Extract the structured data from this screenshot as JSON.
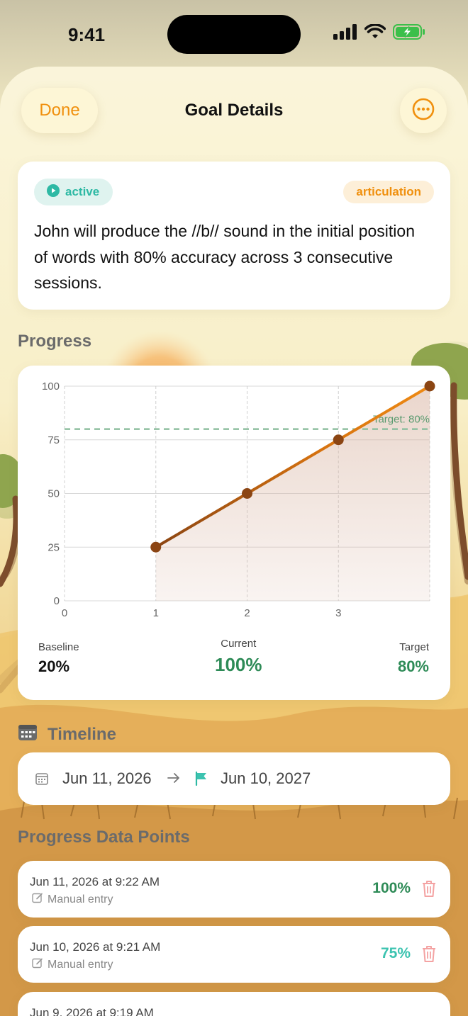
{
  "status_bar": {
    "time": "9:41"
  },
  "nav": {
    "done_label": "Done",
    "title": "Goal Details",
    "more_icon": "ellipsis-circle-icon"
  },
  "goal": {
    "status": "active",
    "category": "articulation",
    "description": "John will produce the //b// sound in the initial position of words with 80% accuracy across 3 consecutive sessions."
  },
  "progress": {
    "section_title": "Progress",
    "chart_data": {
      "type": "line",
      "x": [
        1,
        2,
        3,
        4
      ],
      "y": [
        25,
        50,
        75,
        100
      ],
      "xlim": [
        0,
        4
      ],
      "ylim": [
        0,
        100
      ],
      "x_ticks": [
        "0",
        "1",
        "2",
        "3"
      ],
      "y_ticks": [
        "100",
        "75",
        "50",
        "25",
        "0"
      ],
      "target_value": 80,
      "target_label": "Target: 80%",
      "grid": true,
      "line_color": "#e07c12",
      "point_color": "#8b4513",
      "target_color": "#8fbfa0"
    },
    "stats": {
      "baseline_label": "Baseline",
      "baseline_value": "20%",
      "current_label": "Current",
      "current_value": "100%",
      "target_label": "Target",
      "target_value": "80%"
    }
  },
  "timeline": {
    "section_title": "Timeline",
    "start_date": "Jun 11, 2026",
    "end_date": "Jun 10, 2027"
  },
  "data_points": {
    "section_title": "Progress Data Points",
    "items": [
      {
        "date": "Jun 11, 2026 at 9:22 AM",
        "source": "Manual entry",
        "value": "100%",
        "color": "#2e8b57"
      },
      {
        "date": "Jun 10, 2026 at 9:21 AM",
        "source": "Manual entry",
        "value": "75%",
        "color": "#3cc3b0"
      },
      {
        "date": "Jun 9, 2026 at 9:19 AM",
        "source": "",
        "value": "",
        "color": "#3cc3b0"
      }
    ]
  },
  "colors": {
    "accent_orange": "#f0900e",
    "success_green": "#2e8b57",
    "teal": "#2eb9a4"
  }
}
